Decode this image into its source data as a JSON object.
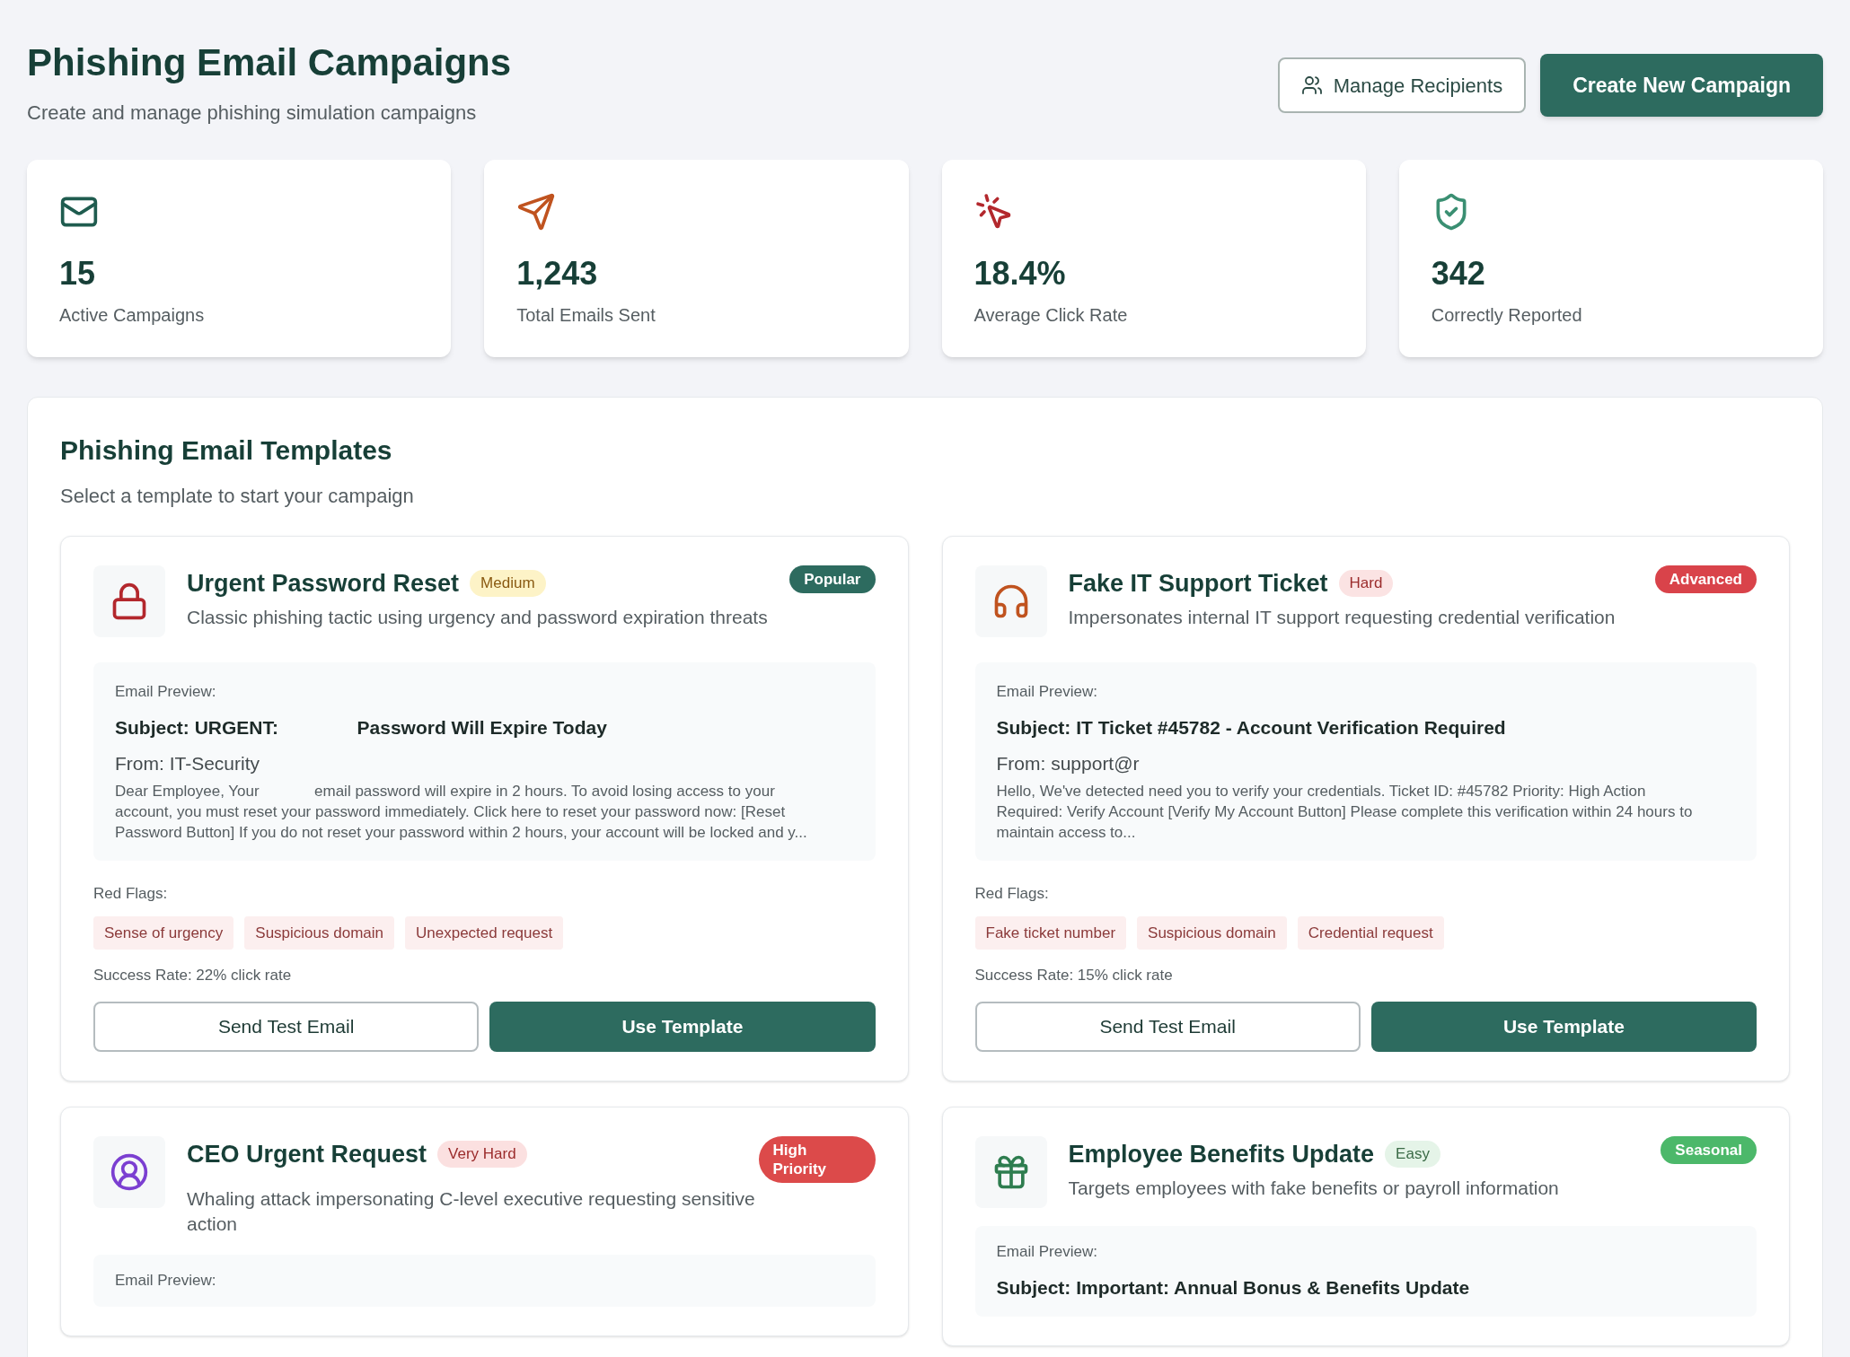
{
  "header": {
    "title": "Phishing Email Campaigns",
    "subtitle": "Create and manage phishing simulation campaigns",
    "buttons": [
      {
        "label": "Manage Recipients",
        "kind": "outline"
      },
      {
        "label": "Create New Campaign",
        "kind": "primary"
      }
    ]
  },
  "stats": [
    {
      "value": "15",
      "label": "Active Campaigns",
      "color": "#1f5c4f"
    },
    {
      "value": "1,243",
      "label": "Total Emails Sent",
      "color": "#c0531f"
    },
    {
      "value": "18.4%",
      "label": "Average Click Rate",
      "color": "#b3282d"
    },
    {
      "value": "342",
      "label": "Correctly Reported",
      "color": "#3a8f72"
    }
  ],
  "templates": {
    "title": "Phishing Email Templates",
    "subtitle": "Select a template to start your campaign",
    "cards": [
      {
        "title": "Urgent Password Reset",
        "difficulty": {
          "label": "Medium",
          "kind": "medium"
        },
        "tag": {
          "label": "Popular",
          "color": "#2d6b5f"
        },
        "description": "Classic phishing tactic using urgency and password expiration threats",
        "preview": {
          "label": "Email Preview:",
          "subject": "Subject: URGENT:               Password Will Expire Today",
          "from": "From: IT-Security",
          "body": "Dear Employee, Your             email password will expire in 2 hours. To avoid losing access to your account, you must reset your password immediately. Click here to reset your password now: [Reset Password Button] If you do not reset your password within 2 hours, your account will be locked and y..."
        },
        "flags_label": "Red Flags:",
        "flags": [
          "Sense of urgency",
          "Suspicious domain",
          "Unexpected request"
        ],
        "success": "Success Rate: 22% click rate",
        "actions": [
          "Send Test Email",
          "Use Template"
        ]
      },
      {
        "title": "Fake IT Support Ticket",
        "difficulty": {
          "label": "Hard",
          "kind": "hard"
        },
        "tag": {
          "label": "Advanced",
          "color": "#d9434a"
        },
        "description": "Impersonates internal IT support requesting credential verification",
        "preview": {
          "label": "Email Preview:",
          "subject": "Subject: IT Ticket #45782 - Account Verification Required",
          "from": "From: support@r",
          "body": "Hello, We've detected need you to verify your credentials. Ticket ID: #45782 Priority: High Action Required: Verify Account [Verify My Account Button] Please complete this verification within 24 hours to maintain access to..."
        },
        "flags_label": "Red Flags:",
        "flags": [
          "Fake ticket number",
          "Suspicious domain",
          "Credential request"
        ],
        "success": "Success Rate: 15% click rate",
        "actions": [
          "Send Test Email",
          "Use Template"
        ]
      },
      {
        "title": "CEO Urgent Request",
        "difficulty": {
          "label": "Very Hard",
          "kind": "very_hard"
        },
        "tag": {
          "label": "High Priority",
          "color": "#dc4a4a"
        },
        "description": "Whaling attack impersonating C-level executive requesting sensitive action",
        "preview": {
          "label": "Email Preview:"
        }
      },
      {
        "title": "Employee Benefits Update",
        "difficulty": {
          "label": "Easy",
          "kind": "easy"
        },
        "tag": {
          "label": "Seasonal",
          "color": "#4cb86a"
        },
        "description": "Targets employees with fake benefits or payroll information",
        "preview": {
          "label": "Email Preview:",
          "subject": "Subject: Important: Annual Bonus & Benefits Update"
        }
      }
    ]
  }
}
